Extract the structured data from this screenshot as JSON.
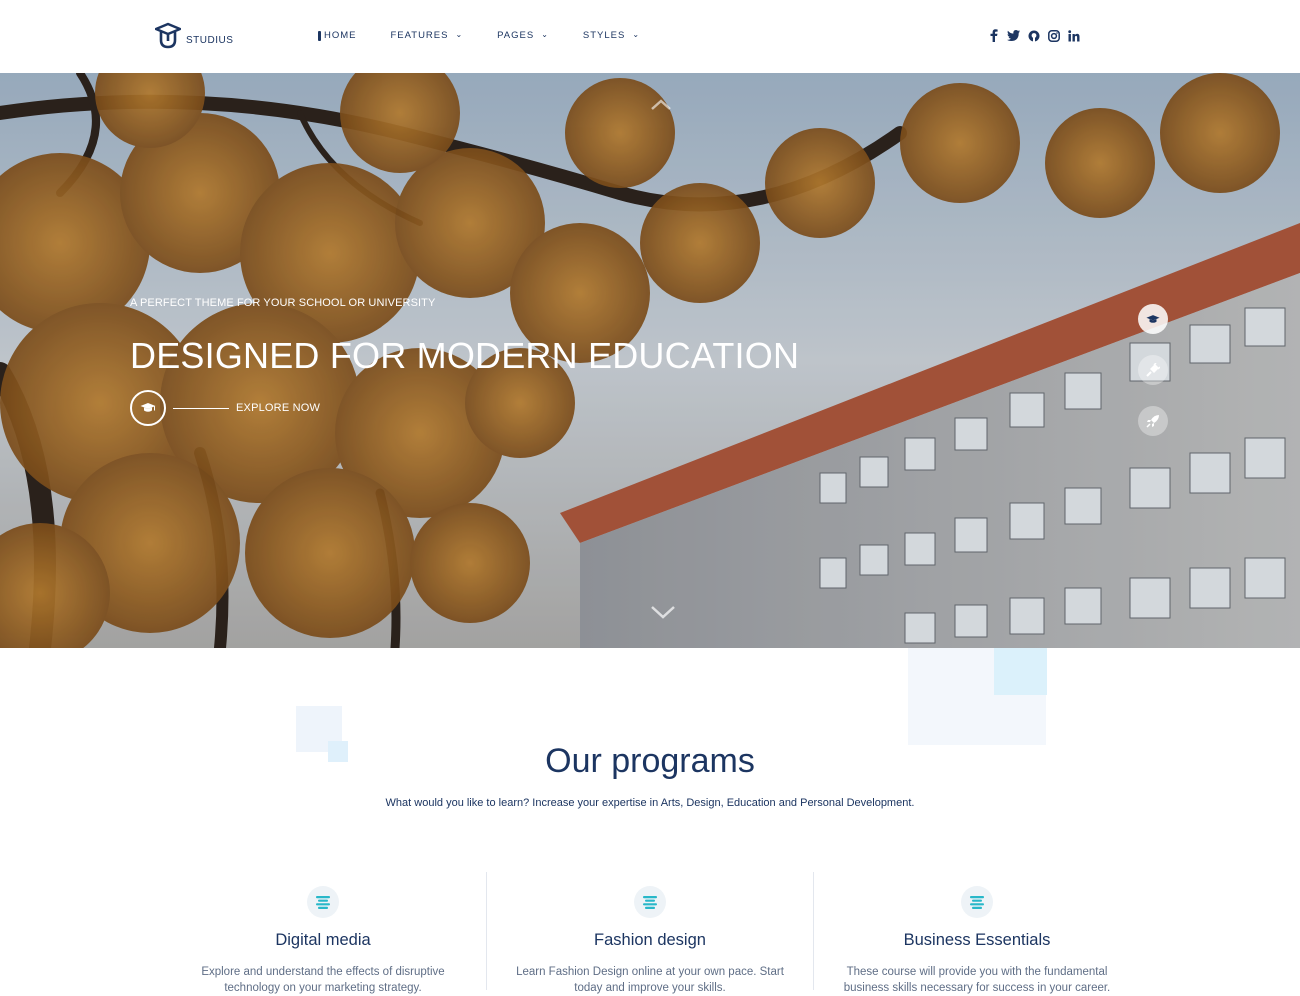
{
  "header": {
    "logo_text": "STUDIUS",
    "nav": [
      {
        "label": "HOME",
        "active": true,
        "dropdown": false
      },
      {
        "label": "FEATURES",
        "active": false,
        "dropdown": true
      },
      {
        "label": "PAGES",
        "active": false,
        "dropdown": true
      },
      {
        "label": "STYLES",
        "active": false,
        "dropdown": true
      }
    ],
    "social_icons": [
      "facebook-icon",
      "twitter-icon",
      "github-icon",
      "instagram-icon",
      "linkedin-icon"
    ],
    "social_glyphs": [
      "f",
      "t",
      "g",
      "i",
      "in"
    ]
  },
  "hero": {
    "subtitle": "A PERFECT THEME FOR YOUR SCHOOL OR UNIVERSITY",
    "title": "DESIGNED FOR MODERN EDUCATION",
    "cta_label": "EXPLORE NOW",
    "slides": [
      "graduation-cap-icon",
      "plug-icon",
      "rocket-icon"
    ],
    "active_slide": 0
  },
  "programs": {
    "title": "Our programs",
    "subtitle": "What would you like to learn? Increase your expertise in Arts, Design, Education and Personal Development.",
    "cards": [
      {
        "title": "Digital media",
        "text": "Explore and understand the effects of disruptive technology on your marketing strategy."
      },
      {
        "title": "Fashion design",
        "text": "Learn Fashion Design online at your own pace. Start today and improve your skills."
      },
      {
        "title": "Business Essentials",
        "text": "These course will provide you with the fundamental business skills necessary for success in your career."
      }
    ]
  },
  "colors": {
    "primary": "#1c3561",
    "accent": "#29b8c9",
    "muted_text": "#5f6e86",
    "deco_blue": "#d8f0fb"
  }
}
